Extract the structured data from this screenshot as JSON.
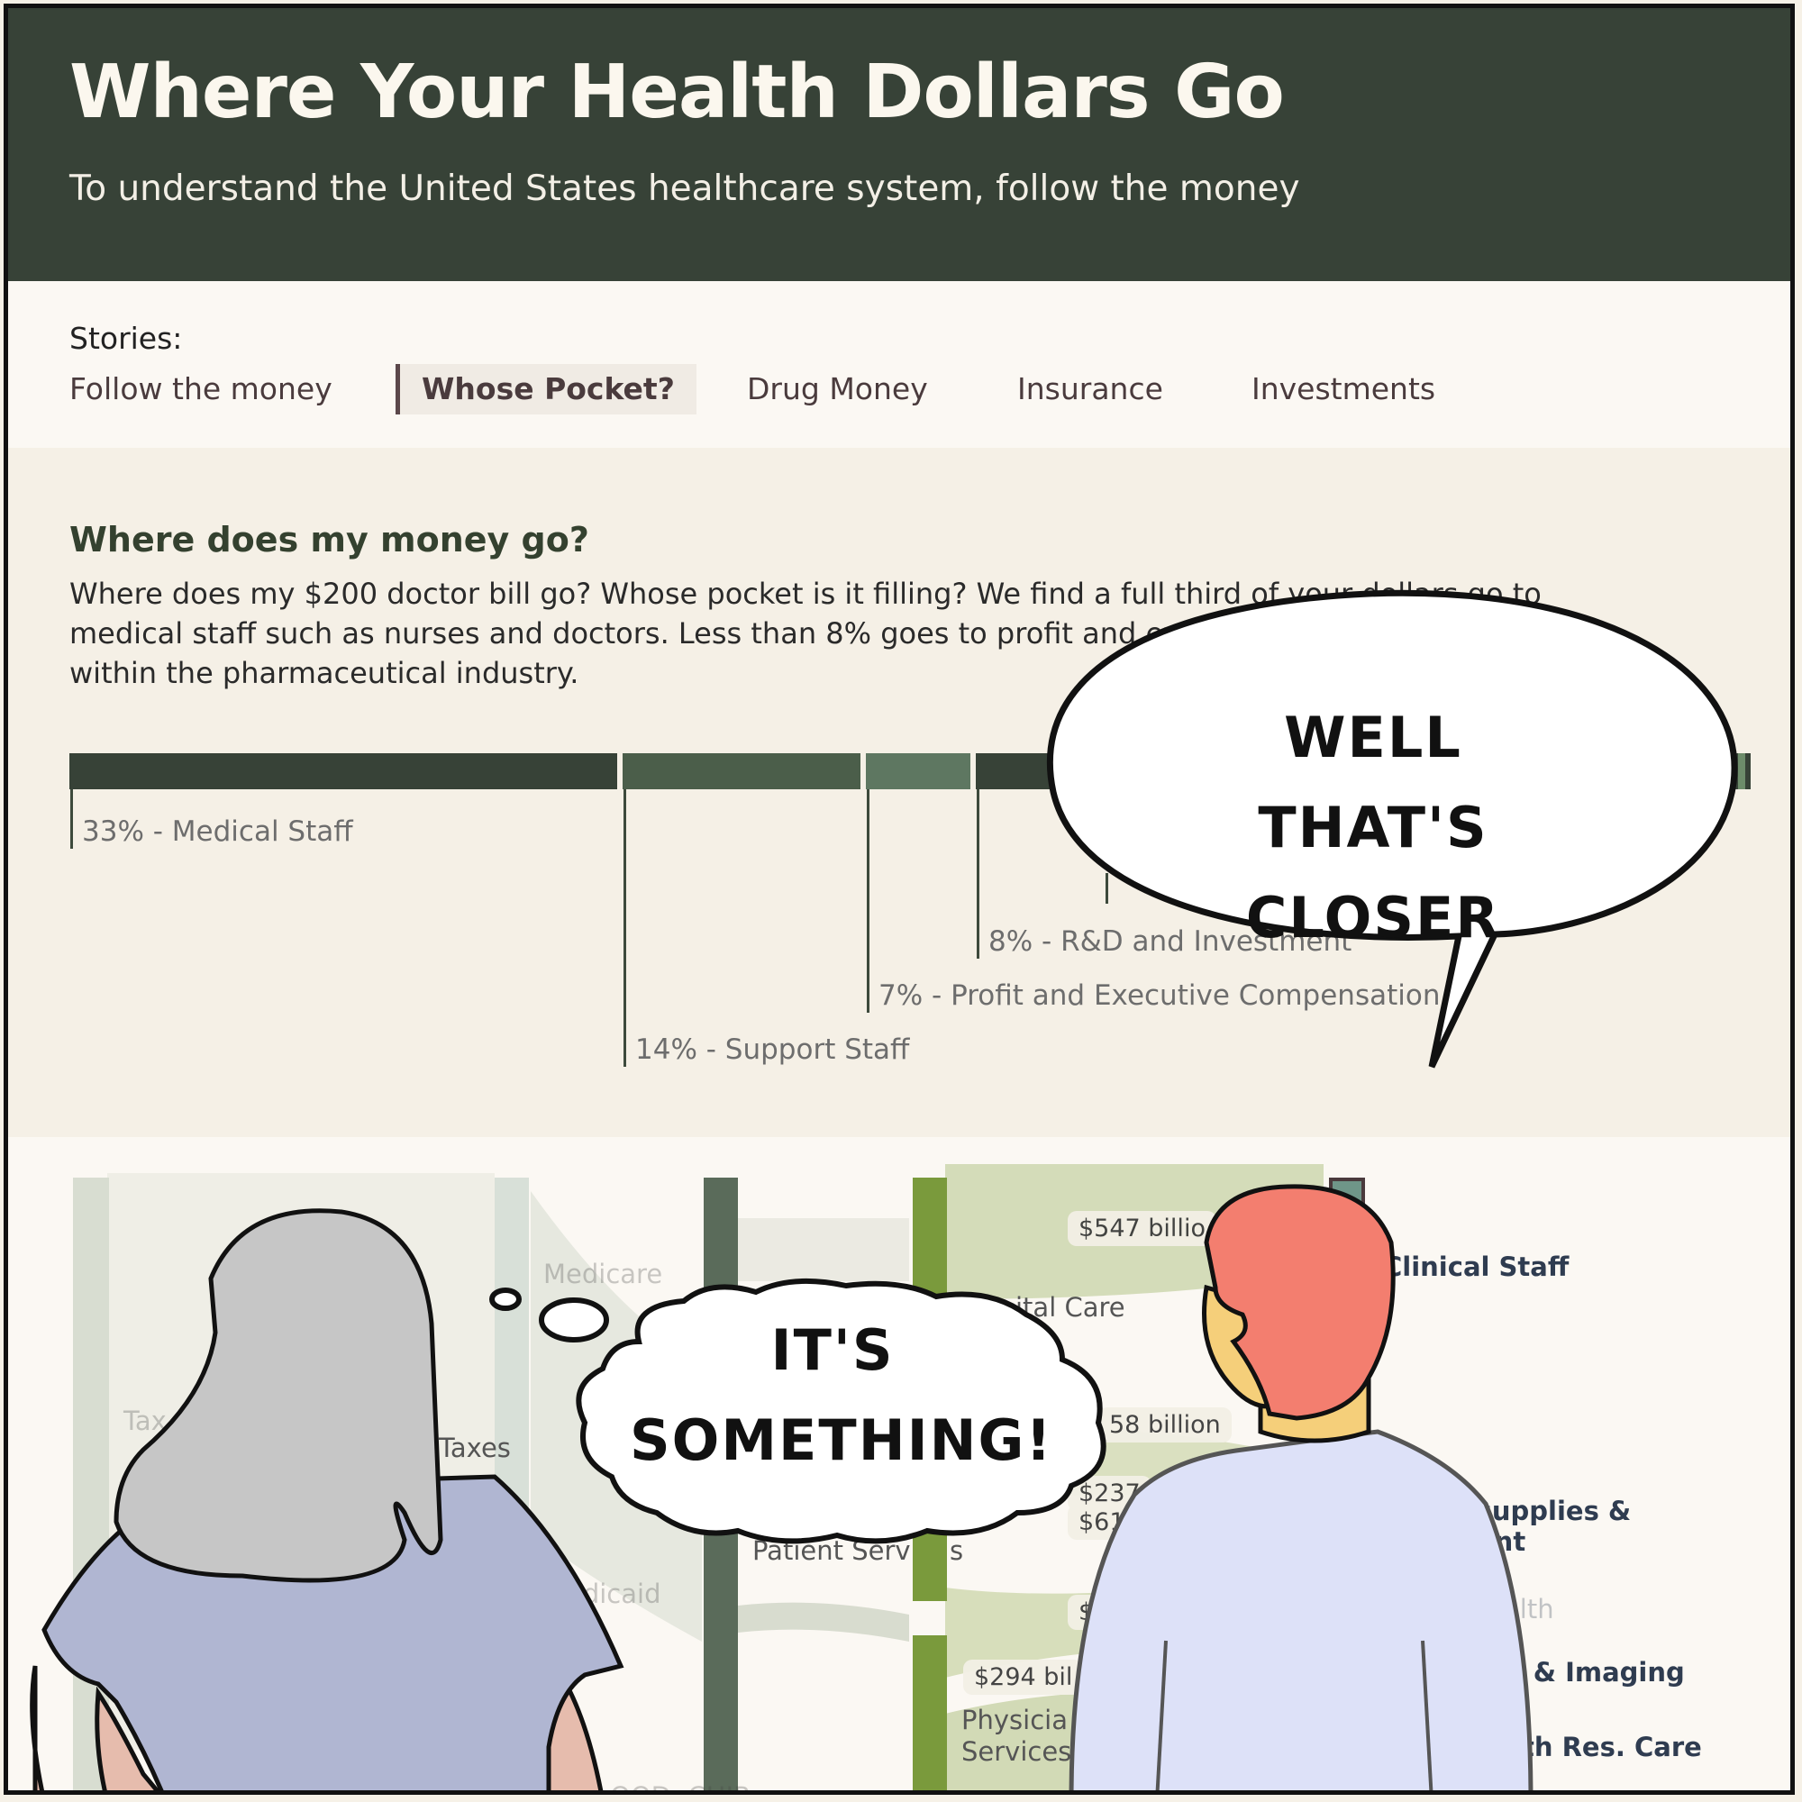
{
  "header": {
    "title": "Where Your Health Dollars Go",
    "subtitle": "To understand the United States healthcare system, follow the money"
  },
  "stories": {
    "label": "Stories:",
    "tabs": [
      {
        "label": "Follow the money",
        "active": false
      },
      {
        "label": "Whose Pocket?",
        "active": true
      },
      {
        "label": "Drug Money",
        "active": false
      },
      {
        "label": "Insurance",
        "active": false
      },
      {
        "label": "Investments",
        "active": false
      }
    ]
  },
  "story": {
    "heading": "Where does my money go?",
    "paragraph_line1": "Where does my $200 doctor bill go? Whose pocket is it filling? We find a full third of your dollars go to",
    "paragraph_line2": "medical staff such as nurses and doctors. Less than 8% goes to profit and executive compensation, mostly",
    "paragraph_line3": "within the pharmaceutical industry."
  },
  "breakdown": {
    "labels": {
      "medical": "33% - Medical Staff",
      "support": "14% - Support Staff",
      "profit": "7% - Profit and Executive Compensation",
      "rd": "8% - R&D and Investment"
    }
  },
  "chart_data": {
    "type": "bar",
    "categories": [
      "Medical Staff",
      "Support Staff",
      "Profit and Executive Compensation",
      "R&D and Investment"
    ],
    "values": [
      33,
      14,
      7,
      8
    ]
  },
  "sankey": {
    "labels": {
      "taxes_left": "Tax",
      "medicare": "Medicare",
      "taxes": "Taxes",
      "medicaid": "edicaid",
      "chip": "OOD, CHIP",
      "hospital_care": "ital Care",
      "patient_services": "Patient Serv",
      "patient_services_end": "s",
      "physician_1": "Physicia",
      "physician_2": "Services",
      "clinical_staff": "Clinical Staff",
      "supplies_1": "al supplies &",
      "supplies_2": "ent",
      "health": "alth",
      "imaging": "/ & Imaging",
      "res_care": "th Res. Care"
    },
    "amounts": {
      "a547": "$547 billio",
      "a58": "58 billion",
      "a237": "$237",
      "a61": "$61",
      "a294": "$294 bil",
      "small": "$"
    }
  },
  "comic": {
    "speech": [
      "WELL THAT'S",
      "CLOSER"
    ],
    "thought": [
      "IT'S",
      "SOMETHING!"
    ]
  }
}
